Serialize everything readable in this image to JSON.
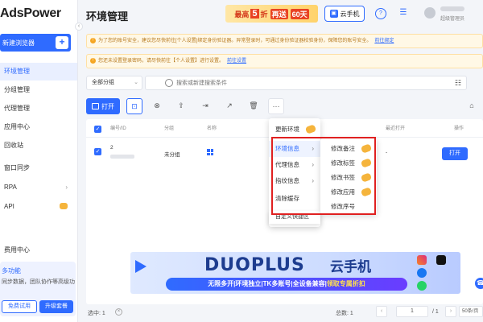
{
  "app": {
    "brand": "AdsPower"
  },
  "sidebar": {
    "new_browser_label": "新建浏览器",
    "items": [
      {
        "label": "环境管理",
        "active": true
      },
      {
        "label": "分组管理"
      },
      {
        "label": "代理管理"
      },
      {
        "label": "应用中心"
      },
      {
        "label": "回收站"
      }
    ],
    "items2": [
      {
        "label": "窗口同步"
      },
      {
        "label": "RPA"
      },
      {
        "label": "API"
      }
    ],
    "items3": [
      {
        "label": "费用中心"
      }
    ],
    "promo": {
      "title": "多功能",
      "desc": "同步数据，团队协作等高级功",
      "trial_label": "免费试用",
      "upgrade_label": "升级套餐"
    }
  },
  "header": {
    "title": "环境管理",
    "banner": {
      "pre": "最高",
      "num": "5",
      "unit": "折",
      "mid": "再送",
      "days": "60天"
    },
    "phone_label": "云手机",
    "user_role": "超级管理员"
  },
  "notices": [
    {
      "text": "为了您的账号安全，建议您尽快前往[个人设置]绑定身份验证器。异常登录时，可通过身份验证器校验身份，保障您的账号安全。",
      "link": "前往绑定"
    },
    {
      "text": "您还未设置登录密码，请尽快前往【个人设置】进行设置。",
      "link": "前往设置"
    }
  ],
  "filters": {
    "group_value": "全部分组",
    "search_placeholder": "搜索或新建搜索条件"
  },
  "toolbar": {
    "open_label": "打开"
  },
  "table": {
    "headers": {
      "id": "编号/ID",
      "group": "分组",
      "name": "名称",
      "last_open": "最近打开",
      "action": "操作"
    },
    "rows": [
      {
        "no": "2",
        "group": "未分组",
        "last_open": "-",
        "open_label": "打开"
      }
    ]
  },
  "menu": {
    "items": [
      {
        "label": "更新环境"
      },
      {
        "label": "环境信息"
      },
      {
        "label": "代理信息"
      },
      {
        "label": "指纹信息"
      },
      {
        "label": "清除缓存"
      },
      {
        "label": "自定义快捷区"
      }
    ],
    "submenu": [
      {
        "label": "修改备注"
      },
      {
        "label": "修改标签"
      },
      {
        "label": "修改书签"
      },
      {
        "label": "修改应用"
      },
      {
        "label": "修改序号"
      }
    ]
  },
  "ad": {
    "brand": "DUOPLUS",
    "cn": "云手机",
    "slogan_a": "无限多开|环境独立|TK多账号|全设备兼容|",
    "slogan_b": "领取专属折扣"
  },
  "footer": {
    "selected": "选中: 1",
    "total": "总数: 1",
    "page": "1",
    "of": "/ 1",
    "page_size": "50条/页"
  },
  "colors": {
    "accent": "#2f6bff",
    "highlight": "#e02020",
    "gold": "#f5b43c"
  }
}
